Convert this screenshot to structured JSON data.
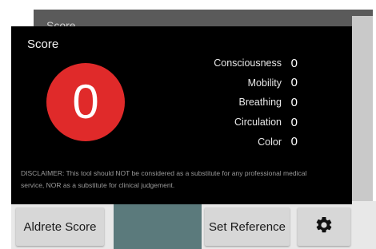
{
  "background_screen": {
    "title": "Score"
  },
  "score_panel": {
    "title": "Score",
    "total_score": "0",
    "score_color": "#e02a2a",
    "criteria": [
      {
        "label": "Consciousness",
        "value": "0"
      },
      {
        "label": "Mobility",
        "value": "0"
      },
      {
        "label": "Breathing",
        "value": "0"
      },
      {
        "label": "Circulation",
        "value": "0"
      },
      {
        "label": "Color",
        "value": "0"
      }
    ],
    "disclaimer": "DISCLAIMER: This tool should NOT be considered as a substitute for any professional medical service, NOR as a substitute for clinical judgement."
  },
  "bottom_bar": {
    "aldrete_button": "Aldrete Score",
    "set_reference_button": "Set Reference",
    "settings_icon": "gear-icon"
  }
}
